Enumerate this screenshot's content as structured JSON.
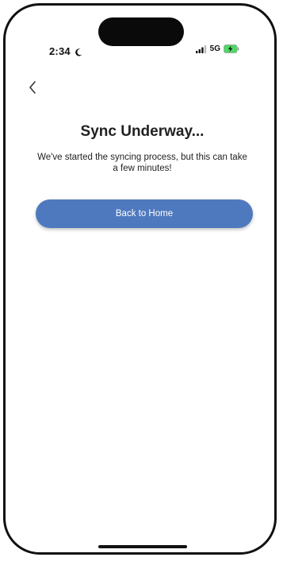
{
  "status_bar": {
    "time": "2:34",
    "network": "5G",
    "icons": [
      "moon-icon",
      "signal-icon",
      "battery-charging-icon"
    ]
  },
  "nav": {
    "back_icon": "chevron-left-icon"
  },
  "main": {
    "title": "Sync Underway...",
    "subtitle": "We've started the syncing process, but this can take a few minutes!",
    "button_label": "Back to Home"
  },
  "colors": {
    "button": "#4f79bf",
    "battery_charging": "#4cd964",
    "text": "#222222"
  }
}
